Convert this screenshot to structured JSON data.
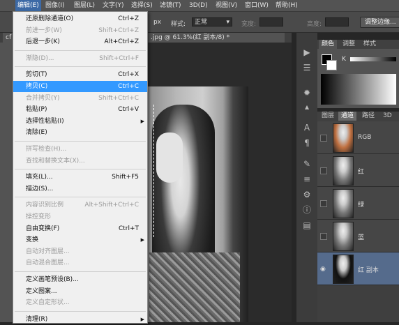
{
  "menubar": {
    "items": [
      {
        "label": "编辑(E)",
        "active": true
      },
      {
        "label": "图像(I)"
      },
      {
        "label": "图层(L)"
      },
      {
        "label": "文字(Y)"
      },
      {
        "label": "选择(S)"
      },
      {
        "label": "滤镜(T)"
      },
      {
        "label": "3D(D)"
      },
      {
        "label": "视图(V)"
      },
      {
        "label": "窗口(W)"
      },
      {
        "label": "帮助(H)"
      }
    ]
  },
  "options": {
    "px_label": "px",
    "style_label": "样式:",
    "style_value": "正常",
    "width_label": "宽度:",
    "height_label": "高度:",
    "refine_button": "调整边缘..."
  },
  "document": {
    "left_tab": "cf",
    "tab_title": ".jpg @ 61.3%(红 副本/8) *"
  },
  "edit_menu": {
    "items": [
      {
        "label": "还原删除通道(O)",
        "shortcut": "Ctrl+Z",
        "state": "enabled"
      },
      {
        "label": "前进一步(W)",
        "shortcut": "Shift+Ctrl+Z",
        "state": "disabled"
      },
      {
        "label": "后退一步(K)",
        "shortcut": "Alt+Ctrl+Z",
        "state": "enabled"
      },
      {
        "sep": true
      },
      {
        "label": "渐隐(D)...",
        "shortcut": "Shift+Ctrl+F",
        "state": "disabled"
      },
      {
        "sep": true
      },
      {
        "label": "剪切(T)",
        "shortcut": "Ctrl+X",
        "state": "enabled"
      },
      {
        "label": "拷贝(C)",
        "shortcut": "Ctrl+C",
        "state": "highlight"
      },
      {
        "label": "合并拷贝(Y)",
        "shortcut": "Shift+Ctrl+C",
        "state": "disabled"
      },
      {
        "label": "粘贴(P)",
        "shortcut": "Ctrl+V",
        "state": "enabled"
      },
      {
        "label": "选择性粘贴(I)",
        "shortcut": "",
        "state": "enabled",
        "submenu": true
      },
      {
        "label": "清除(E)",
        "shortcut": "",
        "state": "enabled"
      },
      {
        "sep": true
      },
      {
        "label": "拼写检查(H)...",
        "shortcut": "",
        "state": "disabled"
      },
      {
        "label": "查找和替换文本(X)...",
        "shortcut": "",
        "state": "disabled"
      },
      {
        "sep": true
      },
      {
        "label": "填充(L)...",
        "shortcut": "Shift+F5",
        "state": "enabled"
      },
      {
        "label": "描边(S)...",
        "shortcut": "",
        "state": "enabled"
      },
      {
        "sep": true
      },
      {
        "label": "内容识别比例",
        "shortcut": "Alt+Shift+Ctrl+C",
        "state": "disabled"
      },
      {
        "label": "操控变形",
        "shortcut": "",
        "state": "disabled"
      },
      {
        "label": "自由变换(F)",
        "shortcut": "Ctrl+T",
        "state": "enabled"
      },
      {
        "label": "变换",
        "shortcut": "",
        "state": "enabled",
        "submenu": true
      },
      {
        "label": "自动对齐图层...",
        "shortcut": "",
        "state": "disabled"
      },
      {
        "label": "自动混合图层...",
        "shortcut": "",
        "state": "disabled"
      },
      {
        "sep": true
      },
      {
        "label": "定义画笔预设(B)...",
        "shortcut": "",
        "state": "enabled"
      },
      {
        "label": "定义图案...",
        "shortcut": "",
        "state": "enabled"
      },
      {
        "label": "定义自定形状...",
        "shortcut": "",
        "state": "disabled"
      },
      {
        "sep": true
      },
      {
        "label": "清理(R)",
        "shortcut": "",
        "state": "enabled",
        "submenu": true
      }
    ]
  },
  "color_panel": {
    "tabs": [
      "颜色",
      "调整",
      "样式"
    ],
    "channel_label": "K"
  },
  "channels_panel": {
    "tabs": [
      "图层",
      "通道",
      "路径",
      "3D"
    ],
    "active_tab": 1,
    "rows": [
      {
        "name": "RGB",
        "color": "#c07040"
      },
      {
        "name": "红",
        "color": "#777"
      },
      {
        "name": "绿",
        "color": "#777"
      },
      {
        "name": "蓝",
        "color": "#777"
      },
      {
        "name": "红 副本",
        "color": "#111",
        "selected": true
      }
    ]
  },
  "colors": {
    "menu_highlight": "#3399ff",
    "active_menu": "#3d6aa6"
  }
}
